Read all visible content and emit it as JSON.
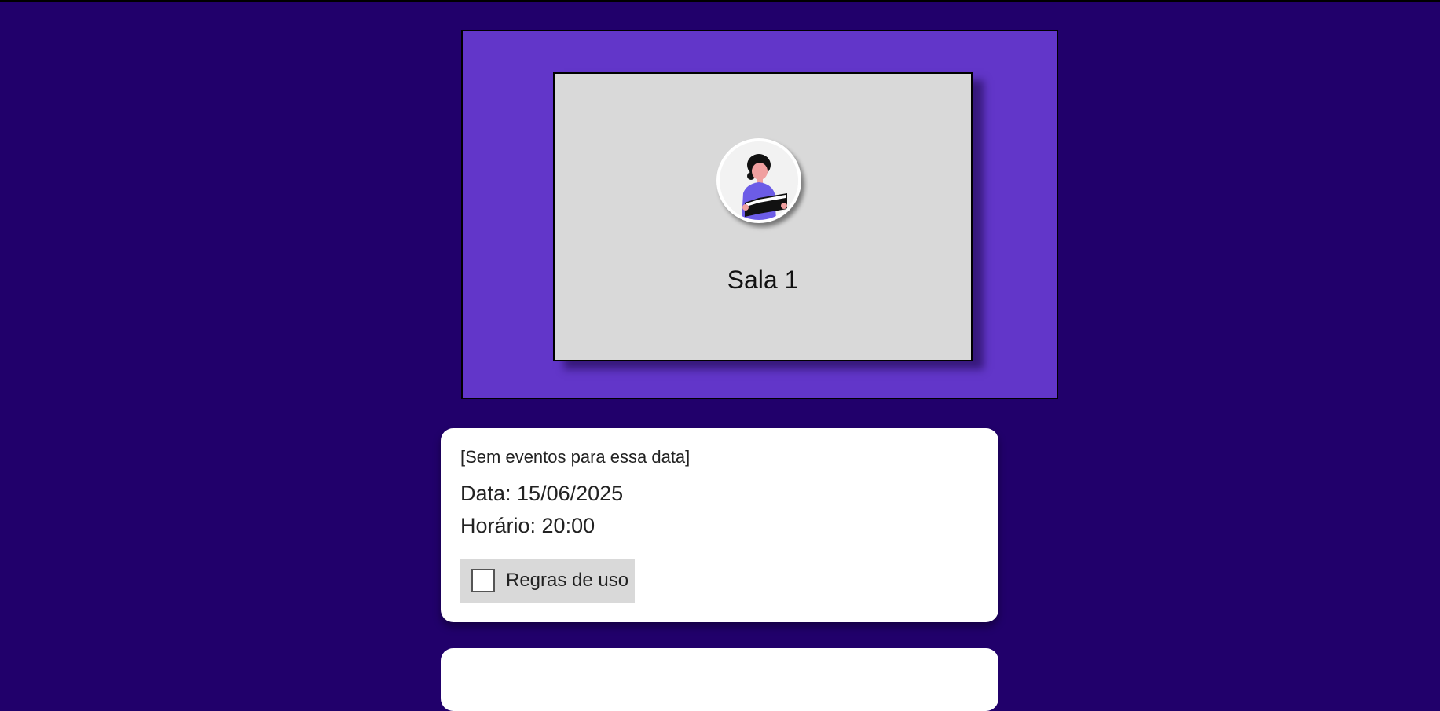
{
  "room": {
    "title": "Sala 1",
    "avatar_icon": "person-reading-icon"
  },
  "event_info": {
    "no_events_text": "[Sem eventos para essa data]",
    "date_text": "Data: 15/06/2025",
    "time_text": "Horário: 20:00",
    "rules_label": "Regras de uso",
    "rules_checked": false
  },
  "colors": {
    "page_background": "#21006b",
    "room_panel": "#6236c9",
    "room_card": "#d9d9d9",
    "card_background": "#ffffff"
  }
}
